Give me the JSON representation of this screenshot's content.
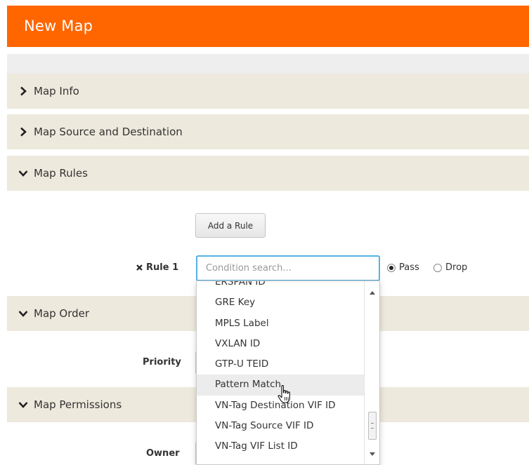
{
  "header": {
    "title": "New Map"
  },
  "sections": {
    "map_info": "Map Info",
    "map_source_destination": "Map Source and Destination",
    "map_rules": "Map Rules",
    "map_order": "Map Order",
    "map_permissions": "Map Permissions"
  },
  "rules": {
    "add_rule_label": "Add a Rule",
    "rule_label": "Rule 1",
    "search_placeholder": "Condition search...",
    "pass_label": "Pass",
    "drop_label": "Drop",
    "selected_action": "Pass"
  },
  "order": {
    "priority_label": "Priority"
  },
  "permissions": {
    "owner_label": "Owner"
  },
  "dropdown": {
    "items": [
      "ERSPAN ID",
      "GRE Key",
      "MPLS Label",
      "VXLAN ID",
      "GTP-U TEID",
      "Pattern Match",
      "VN-Tag Destination VIF ID",
      "VN-Tag Source VIF ID",
      "VN-Tag VIF List ID"
    ],
    "hovered": "Pattern Match"
  },
  "colors": {
    "header_bg": "#ff6600",
    "section_bg": "#ede9dc",
    "input_focus": "#55b2e6"
  },
  "icons": {
    "collapsed": "chevron-right-icon",
    "expanded": "chevron-down-icon",
    "remove": "close-icon",
    "cursor": "hand-pointer-icon"
  }
}
